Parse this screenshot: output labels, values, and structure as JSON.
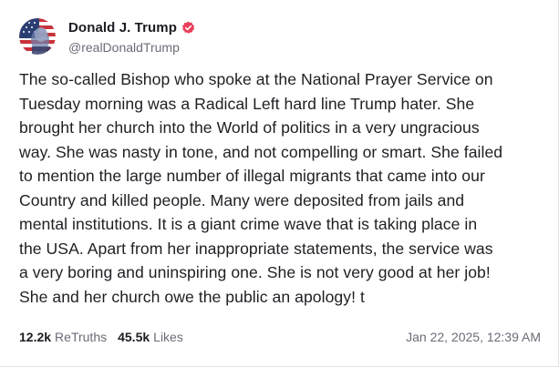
{
  "author": {
    "display_name": "Donald J. Trump",
    "handle": "@realDonaldTrump",
    "verified_icon": "verified-badge-icon",
    "avatar_icon": "profile-avatar"
  },
  "post": {
    "text": "The so-called Bishop who spoke at the National Prayer Service on\nTuesday morning was a Radical Left hard line Trump hater. She\nbrought her church into the World of politics in a very ungracious\nway. She was nasty in tone, and not compelling or smart. She failed\nto mention the large number of illegal migrants that came into our\nCountry and killed people. Many were deposited from jails and\nmental institutions. It is a giant crime wave that is taking place in\nthe USA. Apart from her inappropriate statements, the service was\na very boring and uninspiring one. She is not very good at her job!\nShe and her church owe the public an apology! t"
  },
  "stats": {
    "retruths_count": "12.2k",
    "retruths_label": "ReTruths",
    "likes_count": "45.5k",
    "likes_label": "Likes"
  },
  "timestamp": "Jan 22, 2025, 12:39 AM",
  "colors": {
    "verified_badge": "#e8405a",
    "text_primary": "#1f1f24",
    "text_secondary": "#6b6b78",
    "border": "#e3e3e6"
  }
}
